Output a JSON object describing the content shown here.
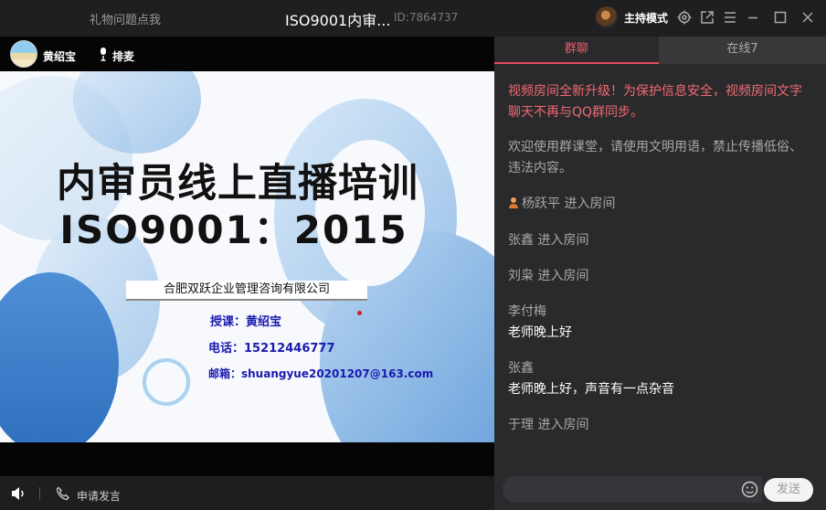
{
  "titlebar": {
    "gift_link": "礼物问题点我",
    "room_title": "ISO9001内审...",
    "room_id": "ID:7864737",
    "host_mode": "主持模式"
  },
  "video": {
    "presenter_name": "黄绍宝",
    "mic_queue_label": "排麦"
  },
  "slide": {
    "title": "内审员线上直播培训",
    "subtitle": "ISO9001：2015",
    "company": "合肥双跃企业管理咨询有限公司",
    "lecturer": "授课：黄绍宝",
    "phone": "电话：15212446777",
    "email": "邮箱：shuangyue20201207@163.com"
  },
  "controls": {
    "apply_speak": "申请发言"
  },
  "chat": {
    "tab_group": "群聊",
    "tab_online": "在线7",
    "notice_red": "视频房间全新升级！为保护信息安全，视频房间文字聊天不再与QQ群同步。",
    "notice_grey": "欢迎使用群课堂，请使用文明用语，禁止传播低俗、违法内容。",
    "events": [
      {
        "text": "杨跃平 进入房间"
      },
      {
        "text": "张鑫 进入房间"
      },
      {
        "text": "刘枭 进入房间"
      }
    ],
    "messages": [
      {
        "name": "李付梅",
        "text": "老师晚上好"
      },
      {
        "name": "张鑫",
        "text": "老师晚上好，声音有一点杂音"
      }
    ],
    "last_event": "于理 进入房间",
    "send_label": "发送"
  },
  "colors": {
    "accent_red": "#e8495a",
    "chat_bg": "#2a2a2c",
    "slide_link_blue": "#1a1ab0"
  }
}
